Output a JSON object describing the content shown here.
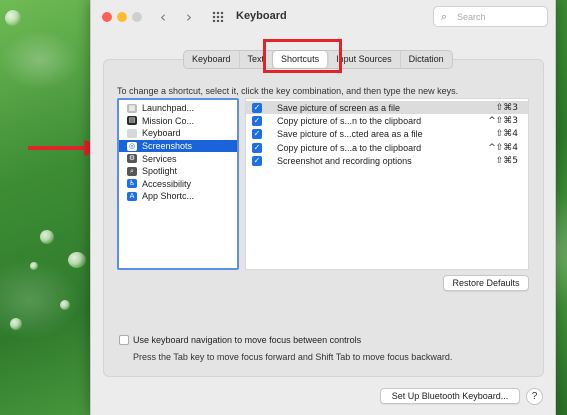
{
  "window": {
    "title": "Keyboard",
    "search_placeholder": "Search"
  },
  "tabs": [
    {
      "label": "Keyboard"
    },
    {
      "label": "Text"
    },
    {
      "label": "Shortcuts"
    },
    {
      "label": "Input Sources"
    },
    {
      "label": "Dictation"
    }
  ],
  "active_tab": "Shortcuts",
  "instructions": "To change a shortcut, select it, click the key combination, and then type the new keys.",
  "categories": [
    {
      "label": "Launchpad...",
      "icon": "launchpad-icon"
    },
    {
      "label": "Mission Co...",
      "icon": "mission-control-icon"
    },
    {
      "label": "Keyboard",
      "icon": "keyboard-icon"
    },
    {
      "label": "Screenshots",
      "icon": "screenshots-icon"
    },
    {
      "label": "Services",
      "icon": "services-icon"
    },
    {
      "label": "Spotlight",
      "icon": "spotlight-icon"
    },
    {
      "label": "Accessibility",
      "icon": "accessibility-icon"
    },
    {
      "label": "App Shortc...",
      "icon": "app-shortcuts-icon"
    }
  ],
  "selected_category": "Screenshots",
  "shortcuts": [
    {
      "checked": true,
      "label": "Save picture of screen as a file",
      "keys": "⇧⌘3"
    },
    {
      "checked": true,
      "label": "Copy picture of s...n to the clipboard",
      "keys": "^⇧⌘3"
    },
    {
      "checked": true,
      "label": "Save picture of s...cted area as a file",
      "keys": "⇧⌘4"
    },
    {
      "checked": true,
      "label": "Copy picture of s...a to the clipboard",
      "keys": "^⇧⌘4"
    },
    {
      "checked": true,
      "label": "Screenshot and recording options",
      "keys": "⇧⌘5"
    }
  ],
  "buttons": {
    "restore_defaults": "Restore Defaults",
    "setup_bluetooth": "Set Up Bluetooth Keyboard...",
    "help": "?"
  },
  "keyboard_navigation": {
    "checked": false,
    "label": "Use keyboard navigation to move focus between controls",
    "hint": "Press the Tab key to move focus forward and Shift Tab to move focus backward."
  },
  "colors": {
    "accent": "#1a63d8",
    "highlight_border": "#e2232a",
    "arrow": "#e2232a"
  }
}
